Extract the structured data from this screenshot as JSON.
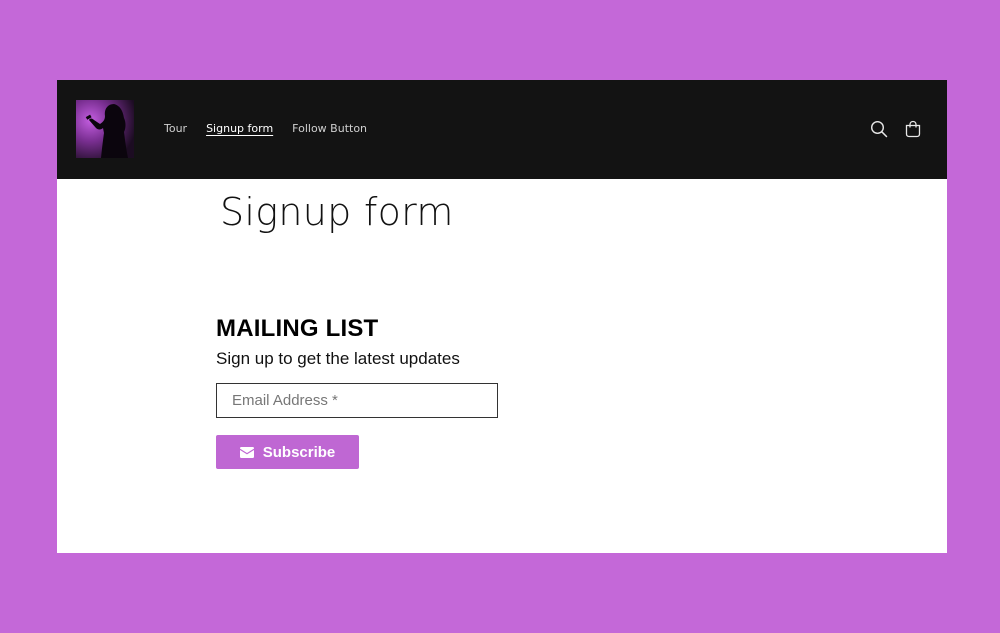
{
  "header": {
    "logo_icon": "performer-silhouette-logo",
    "nav": [
      {
        "label": "Tour",
        "active": false
      },
      {
        "label": "Signup form",
        "active": true
      },
      {
        "label": "Follow Button",
        "active": false
      }
    ],
    "icons": [
      "search-icon",
      "cart-icon"
    ]
  },
  "page": {
    "title": "Signup form"
  },
  "signup": {
    "heading": "MAILING LIST",
    "subheading": "Sign up to get the latest updates",
    "email_placeholder": "Email Address *",
    "email_value": "",
    "button_label": "Subscribe",
    "button_icon": "envelope-icon"
  },
  "colors": {
    "background": "#c468d8",
    "header_bg": "#131313",
    "accent": "#bf67d3"
  }
}
